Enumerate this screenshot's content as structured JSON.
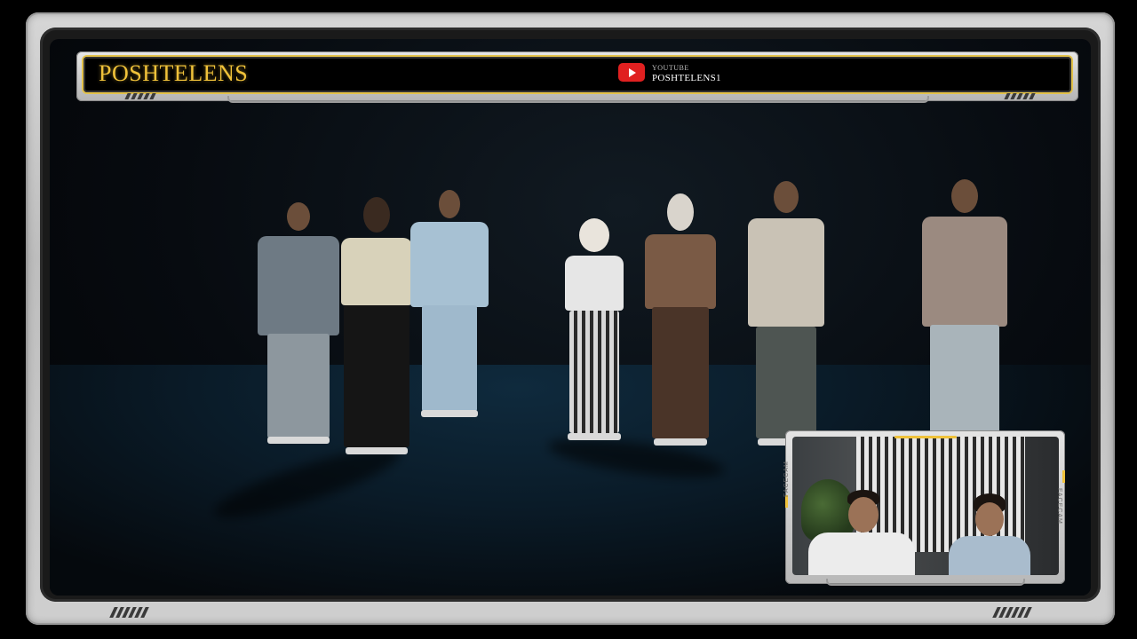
{
  "header": {
    "brand": "POSHTELENS",
    "platform_label": "YOUTUBE",
    "channel_name": "POSHTELENS1",
    "platform_icon": "youtube-icon"
  },
  "facecam": {
    "side_label_left": "FACECAM",
    "side_label_right": "FACECAM"
  },
  "colors": {
    "accent": "#f0c23a",
    "bezel": "#c8c8c8",
    "youtube_red": "#e02020"
  }
}
